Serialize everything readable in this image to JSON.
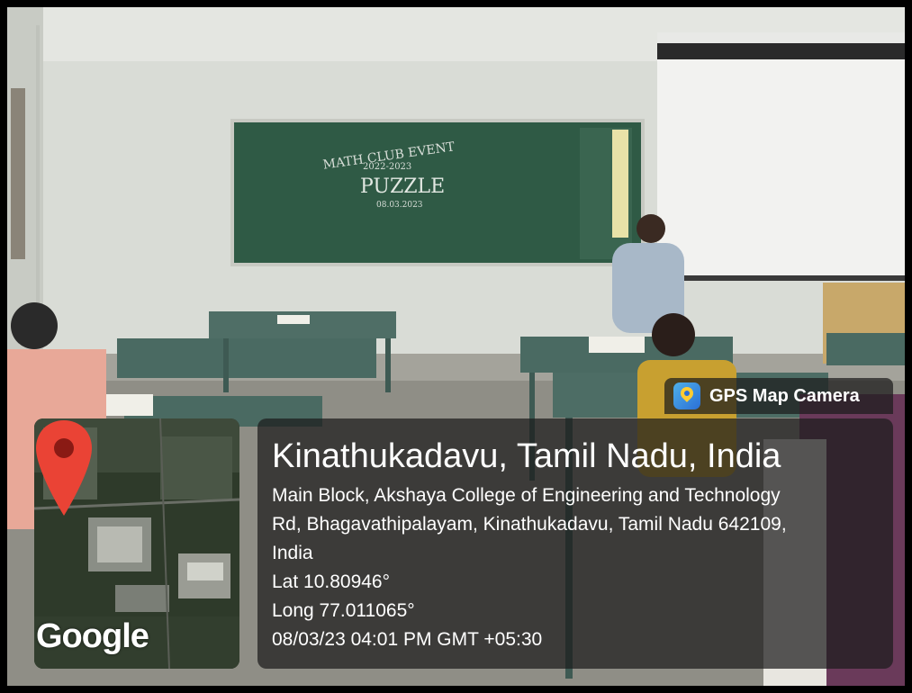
{
  "badge": {
    "label": "GPS Map Camera",
    "icon": "gps-map-camera-icon"
  },
  "map": {
    "logo_text": "Google",
    "pin_color": "#ea4335"
  },
  "info": {
    "title": "Kinathukadavu, Tamil Nadu, India",
    "address_line1": "Main Block, Akshaya College of Engineering and Technology",
    "address_line2": "Rd, Bhagavathipalayam, Kinathukadavu, Tamil Nadu 642109,",
    "address_line3": "India",
    "lat": "Lat 10.80946°",
    "long": "Long 77.011065°",
    "datetime": "08/03/23 04:01 PM GMT +05:30"
  },
  "chalkboard": {
    "line1": "MATH CLUB EVENT",
    "line2": "2022-2023",
    "line3": "PUZZLE",
    "line4": "08.03.2023"
  }
}
